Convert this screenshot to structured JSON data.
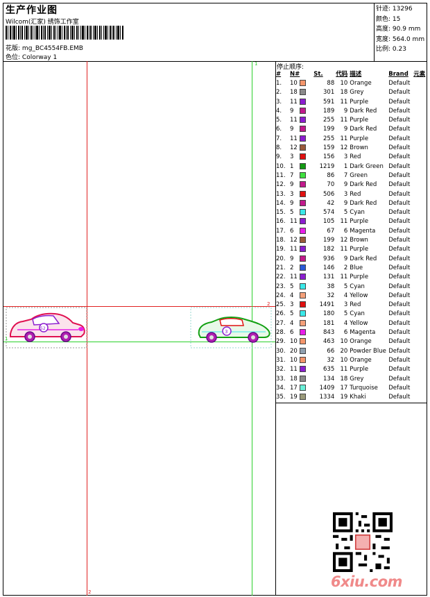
{
  "header": {
    "title": "生产作业图",
    "company": "Wilcom(汇家) 绣饰工作室",
    "design_label": "花版:",
    "design_value": "mg_BC4554FB.EMB",
    "colorway_label": "色位:",
    "colorway_value": "Colorway 1"
  },
  "stats": {
    "stitches_label": "针迹:",
    "stitches_value": "13296",
    "colors_label": "颜色:",
    "colors_value": "15",
    "height_label": "高度:",
    "height_value": "90.9 mm",
    "width_label": "宽度:",
    "width_value": "564.0 mm",
    "scale_label": "比例:",
    "scale_value": "0.23"
  },
  "thread_table": {
    "section_title": "停止顺序:",
    "headers": [
      "#",
      "N#",
      "St.",
      "代码",
      "描述",
      "Brand",
      "元素"
    ],
    "rows": [
      {
        "idx": "1.",
        "n": "10",
        "color": "#f4956b",
        "st": "88",
        "code": "10",
        "desc": "Orange",
        "brand": "Default"
      },
      {
        "idx": "2.",
        "n": "18",
        "color": "#8a8a8a",
        "st": "301",
        "code": "18",
        "desc": "Grey",
        "brand": "Default"
      },
      {
        "idx": "3.",
        "n": "11",
        "color": "#8c1ed0",
        "st": "591",
        "code": "11",
        "desc": "Purple",
        "brand": "Default"
      },
      {
        "idx": "4.",
        "n": "9",
        "color": "#c21a8c",
        "st": "189",
        "code": "9",
        "desc": "Dark Red",
        "brand": "Default"
      },
      {
        "idx": "5.",
        "n": "11",
        "color": "#8c1ed0",
        "st": "255",
        "code": "11",
        "desc": "Purple",
        "brand": "Default"
      },
      {
        "idx": "6.",
        "n": "9",
        "color": "#c21a8c",
        "st": "199",
        "code": "9",
        "desc": "Dark Red",
        "brand": "Default"
      },
      {
        "idx": "7.",
        "n": "11",
        "color": "#8c1ed0",
        "st": "255",
        "code": "11",
        "desc": "Purple",
        "brand": "Default"
      },
      {
        "idx": "8.",
        "n": "12",
        "color": "#9a5a3a",
        "st": "159",
        "code": "12",
        "desc": "Brown",
        "brand": "Default"
      },
      {
        "idx": "9.",
        "n": "3",
        "color": "#e01010",
        "st": "156",
        "code": "3",
        "desc": "Red",
        "brand": "Default"
      },
      {
        "idx": "10.",
        "n": "1",
        "color": "#129a12",
        "st": "1219",
        "code": "1",
        "desc": "Dark Green",
        "brand": "Default"
      },
      {
        "idx": "11.",
        "n": "7",
        "color": "#3ee03e",
        "st": "86",
        "code": "7",
        "desc": "Green",
        "brand": "Default"
      },
      {
        "idx": "12.",
        "n": "9",
        "color": "#c21a8c",
        "st": "70",
        "code": "9",
        "desc": "Dark Red",
        "brand": "Default"
      },
      {
        "idx": "13.",
        "n": "3",
        "color": "#e01010",
        "st": "506",
        "code": "3",
        "desc": "Red",
        "brand": "Default"
      },
      {
        "idx": "14.",
        "n": "9",
        "color": "#c21a8c",
        "st": "42",
        "code": "9",
        "desc": "Dark Red",
        "brand": "Default"
      },
      {
        "idx": "15.",
        "n": "5",
        "color": "#3ae8e8",
        "st": "574",
        "code": "5",
        "desc": "Cyan",
        "brand": "Default"
      },
      {
        "idx": "16.",
        "n": "11",
        "color": "#8c1ed0",
        "st": "105",
        "code": "11",
        "desc": "Purple",
        "brand": "Default"
      },
      {
        "idx": "17.",
        "n": "6",
        "color": "#e81ee8",
        "st": "67",
        "code": "6",
        "desc": "Magenta",
        "brand": "Default"
      },
      {
        "idx": "18.",
        "n": "12",
        "color": "#9a5a3a",
        "st": "199",
        "code": "12",
        "desc": "Brown",
        "brand": "Default"
      },
      {
        "idx": "19.",
        "n": "11",
        "color": "#8c1ed0",
        "st": "182",
        "code": "11",
        "desc": "Purple",
        "brand": "Default"
      },
      {
        "idx": "20.",
        "n": "9",
        "color": "#c21a8c",
        "st": "936",
        "code": "9",
        "desc": "Dark Red",
        "brand": "Default"
      },
      {
        "idx": "21.",
        "n": "2",
        "color": "#2a5ad8",
        "st": "146",
        "code": "2",
        "desc": "Blue",
        "brand": "Default"
      },
      {
        "idx": "22.",
        "n": "11",
        "color": "#8c1ed0",
        "st": "131",
        "code": "11",
        "desc": "Purple",
        "brand": "Default"
      },
      {
        "idx": "23.",
        "n": "5",
        "color": "#3ae8e8",
        "st": "38",
        "code": "5",
        "desc": "Cyan",
        "brand": "Default"
      },
      {
        "idx": "24.",
        "n": "4",
        "color": "#f4a07a",
        "st": "32",
        "code": "4",
        "desc": "Yellow",
        "brand": "Default"
      },
      {
        "idx": "25.",
        "n": "3",
        "color": "#e01010",
        "st": "1491",
        "code": "3",
        "desc": "Red",
        "brand": "Default"
      },
      {
        "idx": "26.",
        "n": "5",
        "color": "#3ae8e8",
        "st": "180",
        "code": "5",
        "desc": "Cyan",
        "brand": "Default"
      },
      {
        "idx": "27.",
        "n": "4",
        "color": "#f4a07a",
        "st": "181",
        "code": "4",
        "desc": "Yellow",
        "brand": "Default"
      },
      {
        "idx": "28.",
        "n": "6",
        "color": "#e81ee8",
        "st": "843",
        "code": "6",
        "desc": "Magenta",
        "brand": "Default"
      },
      {
        "idx": "29.",
        "n": "10",
        "color": "#f4956b",
        "st": "463",
        "code": "10",
        "desc": "Orange",
        "brand": "Default"
      },
      {
        "idx": "30.",
        "n": "20",
        "color": "#8fa0b0",
        "st": "66",
        "code": "20",
        "desc": "Powder Blue",
        "brand": "Default"
      },
      {
        "idx": "31.",
        "n": "10",
        "color": "#f4956b",
        "st": "32",
        "code": "10",
        "desc": "Orange",
        "brand": "Default"
      },
      {
        "idx": "32.",
        "n": "11",
        "color": "#8c1ed0",
        "st": "635",
        "code": "11",
        "desc": "Purple",
        "brand": "Default"
      },
      {
        "idx": "33.",
        "n": "18",
        "color": "#8a8a8a",
        "st": "134",
        "code": "18",
        "desc": "Grey",
        "brand": "Default"
      },
      {
        "idx": "34.",
        "n": "17",
        "color": "#6af0d8",
        "st": "1409",
        "code": "17",
        "desc": "Turquoise",
        "brand": "Default"
      },
      {
        "idx": "35.",
        "n": "19",
        "color": "#9a9a7a",
        "st": "1334",
        "code": "19",
        "desc": "Khaki",
        "brand": "Default"
      }
    ]
  },
  "canvas": {
    "axis_label_1": "1",
    "axis_label_2": "2",
    "car_left_number": "52",
    "car_right_number": "3"
  },
  "watermark": {
    "site": "6xiu.com"
  }
}
